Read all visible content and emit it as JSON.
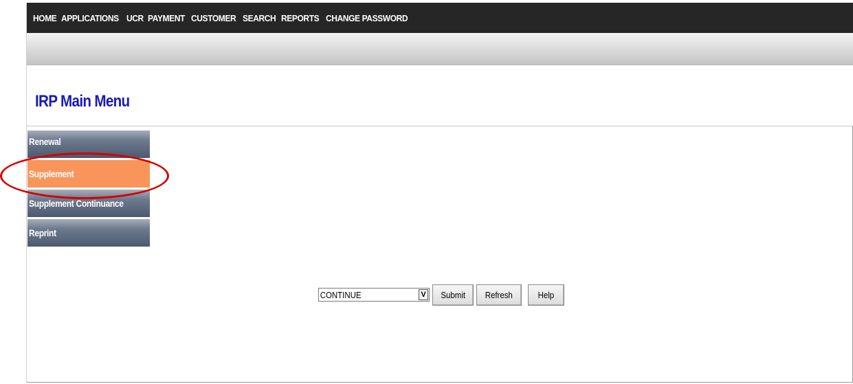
{
  "topnav": {
    "items": [
      "HOME",
      "APPLICATIONS",
      "UCR",
      "PAYMENT",
      "CUSTOMER",
      "SEARCH",
      "REPORTS",
      "CHANGE PASSWORD"
    ]
  },
  "page": {
    "title": "IRP Main Menu"
  },
  "sidemenu": {
    "items": [
      {
        "label": "Renewal"
      },
      {
        "label": "Supplement"
      },
      {
        "label": "Supplement Continuance"
      },
      {
        "label": "Reprint"
      }
    ],
    "active_index": 1
  },
  "colors": {
    "nav_bg": "#262626",
    "title": "#1a1ab8",
    "menu_active": "#f9955a",
    "menu_default": "#5a677c",
    "highlight_ring": "#d40000"
  },
  "controls": {
    "select_value": "CONTINUE",
    "submit_label": "Submit",
    "refresh_label": "Refresh",
    "help_label": "Help"
  },
  "icons": {
    "dropdown": "chevron-down-icon"
  }
}
